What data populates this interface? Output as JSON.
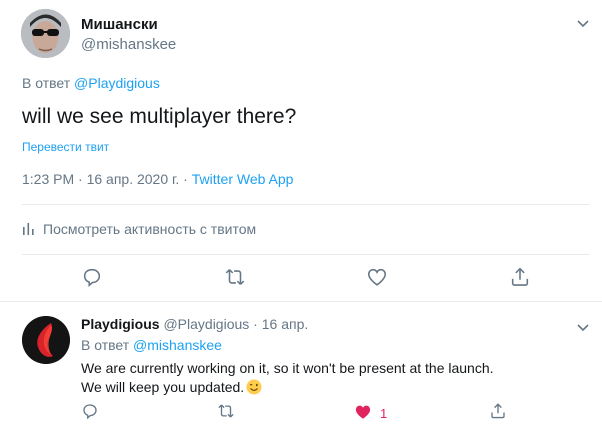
{
  "main_tweet": {
    "author_name": "Мишански",
    "author_handle": "@mishanskee",
    "reply_prefix": "В ответ",
    "reply_mention": "@Playdigious",
    "text": "will we see multiplayer there?",
    "translate_label": "Перевести твит",
    "timestamp": "1:23 PM · 16 апр. 2020 г. · ",
    "source_app": "Twitter Web App",
    "activity_label": "Посмотреть активность с твитом",
    "actions": [
      "reply-icon",
      "retweet-icon",
      "like-icon",
      "share-icon"
    ]
  },
  "reply_tweet": {
    "author_name": "Playdigious",
    "author_handle": "@Playdigious",
    "separator": "·",
    "date": "16 апр.",
    "reply_prefix": "В ответ",
    "reply_mention": "@mishanskee",
    "line1": "We are currently working on it, so it won't be present at the launch.",
    "line2": "We will keep you updated.",
    "emoji": "winking-face-emoji",
    "like_count": "1",
    "liked": true
  },
  "colors": {
    "text_primary": "#14171a",
    "text_secondary": "#657786",
    "link": "#1da1f2",
    "like": "#e0245e",
    "divider": "#e6ecf0"
  }
}
